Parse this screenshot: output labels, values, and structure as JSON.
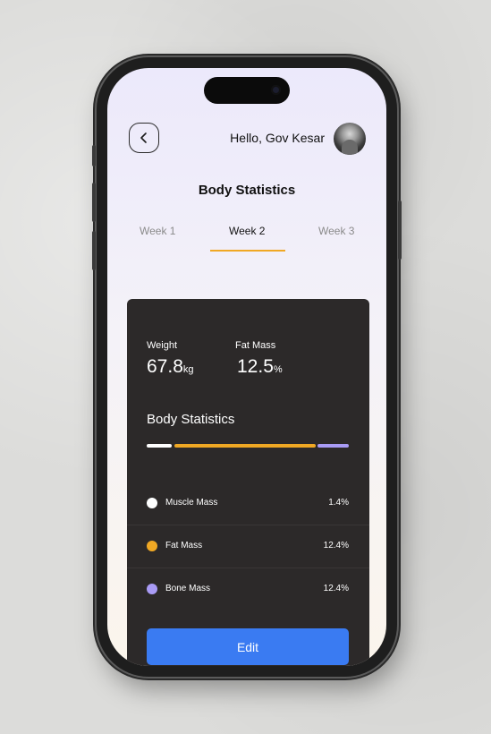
{
  "header": {
    "greeting": "Hello, Gov Kesar",
    "back_icon": "chevron-left-icon"
  },
  "page": {
    "title": "Body Statistics"
  },
  "tabs": [
    {
      "label": "Week 1",
      "active": false
    },
    {
      "label": "Week 2",
      "active": true
    },
    {
      "label": "Week 3",
      "active": false
    }
  ],
  "stats": {
    "weight": {
      "label": "Weight",
      "value": "67.8",
      "unit": "kg"
    },
    "fat_mass": {
      "label": "Fat Mass",
      "value": "12.5",
      "unit": "%"
    }
  },
  "breakdown": {
    "title": "Body Statistics",
    "items": [
      {
        "label": "Muscle Mass",
        "percent": "1.4%",
        "color": "#ffffff"
      },
      {
        "label": "Fat Mass",
        "percent": "12.4%",
        "color": "#f0a824"
      },
      {
        "label": "Bone Mass",
        "percent": "12.4%",
        "color": "#a99bf5"
      }
    ]
  },
  "actions": {
    "edit_label": "Edit"
  },
  "colors": {
    "card_bg": "#2c2929",
    "accent": "#f0a824",
    "primary_button": "#3a7bf2"
  }
}
